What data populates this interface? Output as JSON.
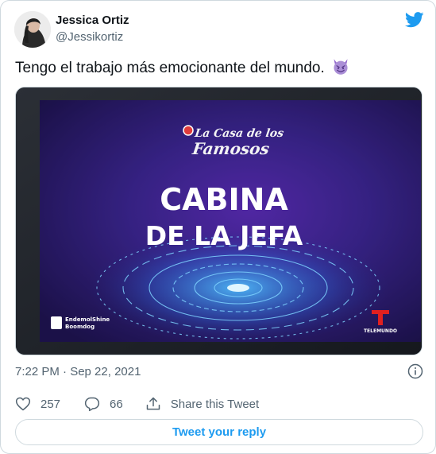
{
  "author": {
    "name": "Jessica Ortiz",
    "handle": "@Jessikortiz"
  },
  "tweet": {
    "text": "Tengo el trabajo más emocionante del mundo.",
    "emoji": "smiling-imp-emoji"
  },
  "media": {
    "logo_line1": "La Casa de los",
    "logo_line2": "Famosos",
    "headline_line1": "CABINA",
    "headline_line2": "DE LA JEFA",
    "producer_line1": "EndemolShine",
    "producer_line2": "Boomdog",
    "network": "TELEMUNDO"
  },
  "meta": {
    "timestamp": "7:22 PM · Sep 22, 2021"
  },
  "actions": {
    "likes": "257",
    "replies": "66",
    "share_label": "Share this Tweet"
  },
  "reply_button": {
    "label": "Tweet your reply"
  },
  "colors": {
    "twitter_blue": "#1d9bf0",
    "text_primary": "#0f1419",
    "text_secondary": "#536471",
    "border": "#cfd9de"
  }
}
